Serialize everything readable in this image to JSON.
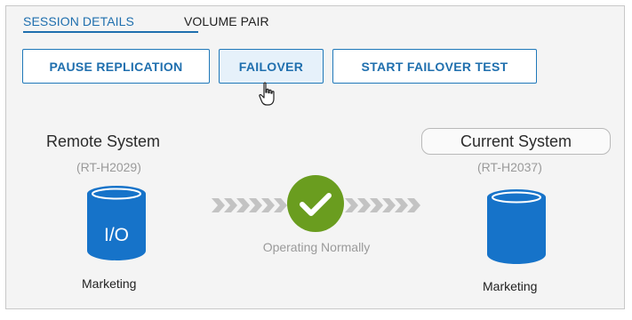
{
  "tabs": {
    "session_details": "SESSION DETAILS",
    "volume_pair": "VOLUME PAIR"
  },
  "actions": {
    "pause_replication": "PAUSE REPLICATION",
    "failover": "FAILOVER",
    "start_failover_test": "START FAILOVER TEST"
  },
  "remote_system": {
    "title": "Remote System",
    "id": "(RT-H2029)",
    "disk_label": "I/O",
    "volume": "Marketing"
  },
  "current_system": {
    "title": "Current System",
    "id": "(RT-H2037)",
    "volume": "Marketing"
  },
  "status": {
    "text": "Operating Normally",
    "color": "#6a9d1f"
  },
  "colors": {
    "accent": "#1f6fae",
    "disk": "#1673c9",
    "arrow": "#c3c3c3"
  }
}
